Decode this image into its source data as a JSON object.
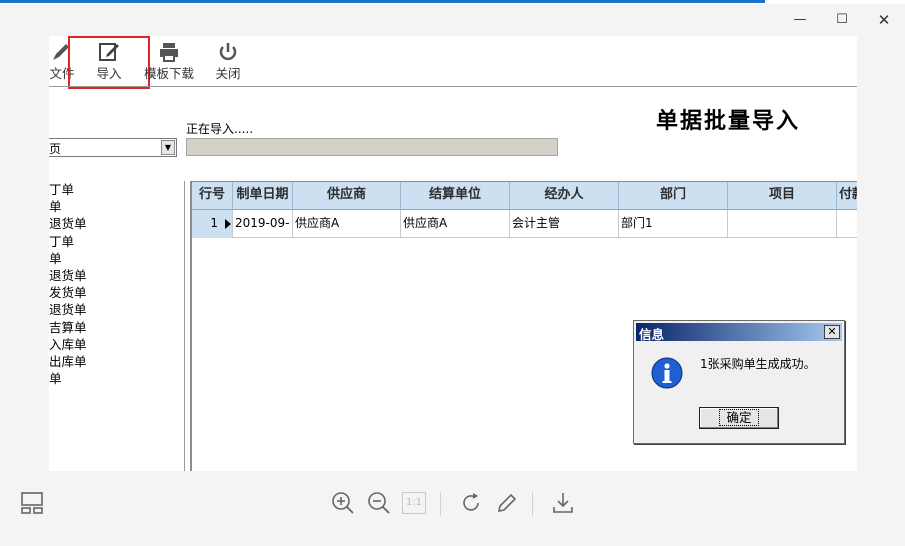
{
  "toolbar": {
    "file_label": "文件",
    "import_label": "导入",
    "template_label": "模板下载",
    "close_label": "关闭"
  },
  "form": {
    "title": "单据批量导入",
    "status_text": "正在导入.....",
    "combo_value": "页"
  },
  "left_list": [
    "丁单",
    "单",
    "退货单",
    "丁单",
    "单",
    "退货单",
    "发货单",
    "退货单",
    "吉算单",
    "入库单",
    "出库单",
    "单"
  ],
  "grid": {
    "headers": [
      "行号",
      "制单日期",
      "供应商",
      "结算单位",
      "经办人",
      "部门",
      "项目",
      "付款"
    ],
    "rows": [
      [
        "1",
        "2019-09-",
        "供应商A",
        "供应商A",
        "会计主管",
        "部门1",
        "",
        ""
      ]
    ],
    "header_bg": "#cde0f2"
  },
  "dialog": {
    "title": "信息",
    "message": "1张采购单生成成功。",
    "ok_label": "确定"
  },
  "viewer_toolbar": {
    "icons": [
      "layout-icon",
      "zoom-in-icon",
      "zoom-out-icon",
      "actual-size-icon",
      "rotate-icon",
      "edit-icon",
      "download-icon"
    ],
    "page_indicator": "1:1"
  },
  "colors": {
    "highlight": "#e0242a",
    "accent": "#1a73c8"
  }
}
